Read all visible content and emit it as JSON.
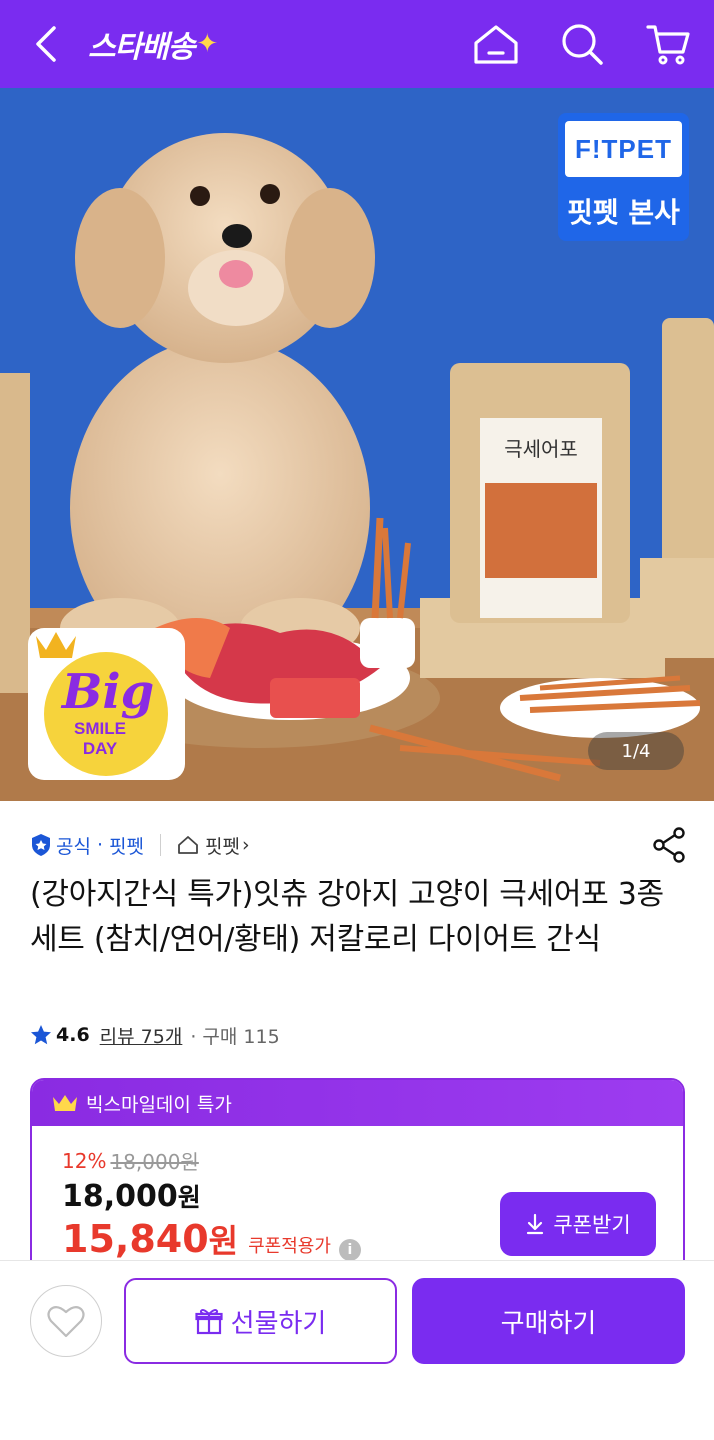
{
  "header": {
    "logo_text": "스타배송",
    "logo_star": "✦"
  },
  "hero": {
    "brand_logo": "F!TPET",
    "brand_label": "핏펫 본사",
    "badge_big": "Big",
    "badge_smile": "SMILE",
    "badge_day": "DAY",
    "counter": "1/4",
    "bag_label": "극세어포"
  },
  "seller": {
    "official": "공식",
    "name": "핏펫",
    "shop": "핏펫",
    "shop_chevron": "›"
  },
  "product": {
    "title": "(강아지간식 특가)잇츄 강아지 고양이 극세어포 3종세트 (참치/연어/황태) 저칼로리 다이어트 간식",
    "rating": "4.6",
    "review_label": "리뷰 75개",
    "purchase_label": "· 구매 115"
  },
  "deal": {
    "head_label": "빅스마일데이 특가",
    "discount_pct": "12%",
    "original_price": "18,000원",
    "price": "18,000",
    "price_unit": "원",
    "coupon_price": "15,840",
    "coupon_unit": "원",
    "coupon_applied": "쿠폰적용가",
    "info": "i",
    "coupon_button": "쿠폰받기"
  },
  "bottom": {
    "gift_button": "선물하기",
    "buy_button": "구매하기"
  },
  "colors": {
    "brand_purple": "#7a2cf0",
    "sale_red": "#e8392c",
    "link_blue": "#1b56d6"
  }
}
